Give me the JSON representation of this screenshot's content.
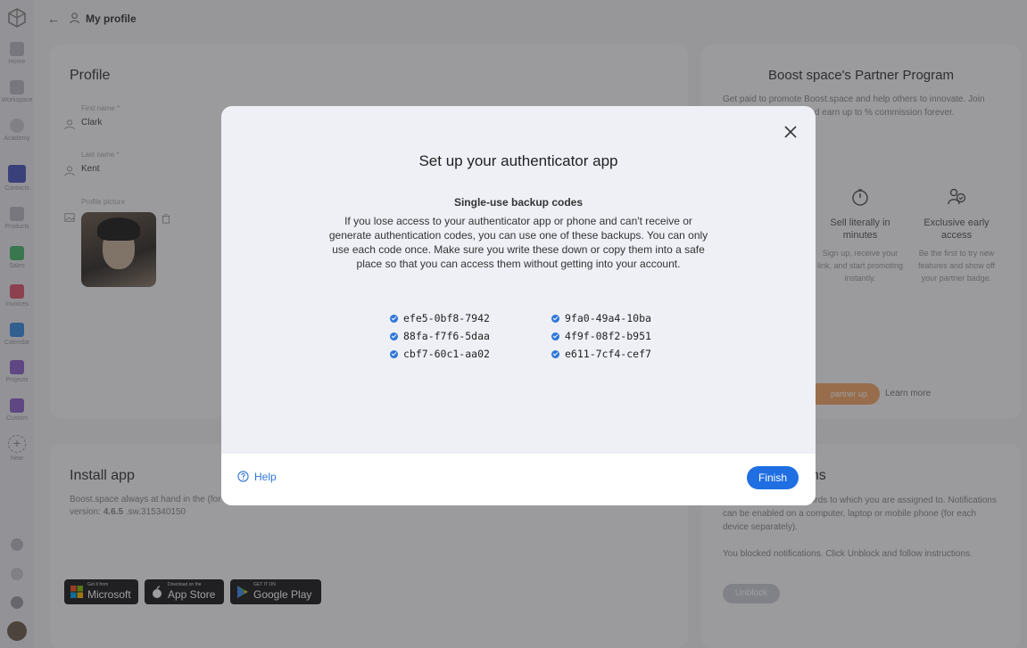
{
  "topbar": {
    "back_icon": "arrow-left-icon",
    "title_icon": "user-icon",
    "title": "My profile"
  },
  "sidebar": {
    "items": [
      {
        "label": "Home",
        "icon": "home-icon",
        "color": "#b9b9bf"
      },
      {
        "label": "Workspace",
        "icon": "workspace-icon",
        "color": "#b9b9bf"
      },
      {
        "label": "Academy",
        "icon": "academy-icon",
        "color": "#c9c9ce"
      },
      {
        "label": "Contacts",
        "icon": "contacts-icon",
        "color": "#4a55b8"
      },
      {
        "label": "Products",
        "icon": "products-icon",
        "color": "#b9b9bf"
      },
      {
        "label": "Sales",
        "icon": "sales-icon",
        "color": "#47b86a"
      },
      {
        "label": "Invoices",
        "icon": "invoices-icon",
        "color": "#e0566b"
      },
      {
        "label": "Calendar",
        "icon": "calendar-icon",
        "color": "#3a8de0"
      },
      {
        "label": "Projects",
        "icon": "projects-icon",
        "color": "#8a62c9"
      },
      {
        "label": "Custom",
        "icon": "custom-icon",
        "color": "#8a62c9"
      },
      {
        "label": "New",
        "icon": "plus-icon",
        "color": "#b9b9bf"
      }
    ]
  },
  "profile": {
    "heading": "Profile",
    "first_name_label": "First name *",
    "first_name": "Clark",
    "last_name_label": "Last name *",
    "last_name": "Kent",
    "picture_label": "Profile picture"
  },
  "partner": {
    "title": "Boost space's Partner Program",
    "description": "Get paid to promote Boost.space and help others to innovate. Join our partner program and earn up to % commission forever.",
    "features": [
      {
        "title": "Sell literally in minutes",
        "desc": "Sign up, receive your link, and start promoting instantly."
      },
      {
        "title": "Exclusive early access",
        "desc": "Be the first to try new features and show off your partner badge."
      }
    ],
    "button": "partner up",
    "learn_more": "Learn more"
  },
  "install": {
    "heading": "Install app",
    "description": "Boost.space always at hand in the (for each device separately). Application version:",
    "version": "4.6.5",
    "build": ".sw.315340150",
    "badges": [
      {
        "small": "Get it from",
        "name": "Microsoft"
      },
      {
        "small": "Download on the",
        "name": "App Store"
      },
      {
        "small": "GET IT ON",
        "name": "Google Play"
      }
    ]
  },
  "notifications": {
    "title_partial": "ons",
    "description": "ges to spaces and records to which you are assigned to. Notifications can be enabled on a computer, laptop or mobile phone (for each device separately).",
    "blocked": "You blocked notifications. Click Unblock and follow instructions.",
    "unblock": "Unblock"
  },
  "modal": {
    "title": "Set up your authenticator app",
    "subtitle": "Single-use backup codes",
    "body": "If you lose access to your authenticator app or phone and can't receive or generate authentication codes, you can use one of these backups. You can only use each code once. Make sure you write these down or copy them into a safe place so that you can access them without getting into your account.",
    "codes_left": [
      "efe5-0bf8-7942",
      "88fa-f7f6-5daa",
      "cbf7-60c1-aa02"
    ],
    "codes_right": [
      "9fa0-49a4-10ba",
      "4f9f-08f2-b951",
      "e611-7cf4-cef7"
    ],
    "help": "Help",
    "finish": "Finish"
  },
  "colors": {
    "accent": "#1f6fe3",
    "check": "#2f77d8",
    "overlay": "rgba(40,40,45,0.45)"
  }
}
